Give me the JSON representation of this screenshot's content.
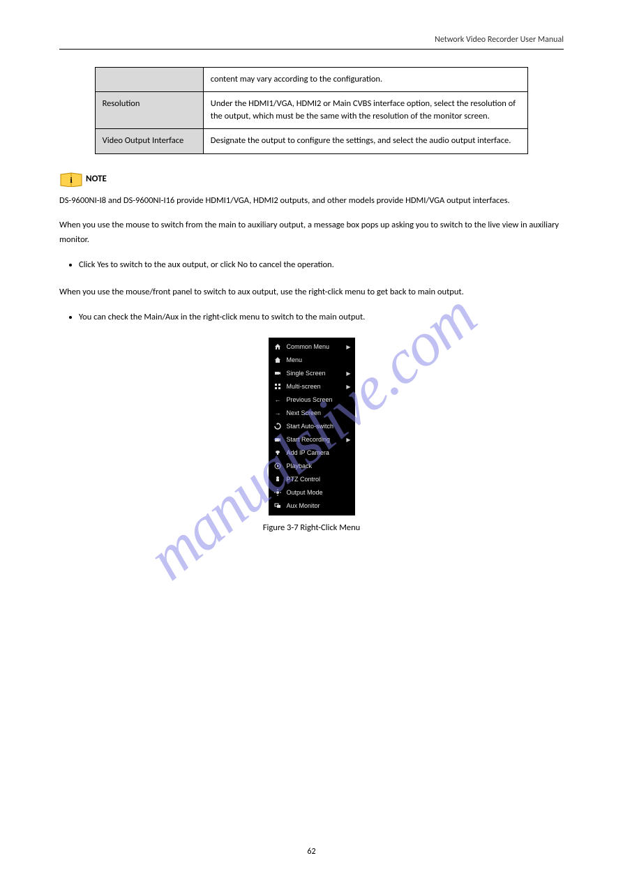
{
  "header": {
    "title": "Network Video Recorder User Manual"
  },
  "watermark": "manualslive.com",
  "table": {
    "rows": [
      {
        "label": "",
        "value": "content may vary according to the configuration."
      },
      {
        "label": "Resolution",
        "value": "Under the HDMI1/VGA, HDMI2 or Main CVBS interface option, select the resolution of the output, which must be the same with the resolution of the monitor screen."
      },
      {
        "label": "Video Output Interface",
        "value": "Designate the output to configure the settings, and select the audio output interface."
      }
    ]
  },
  "note": {
    "label": "NOTE"
  },
  "body": {
    "p1": "DS-9600NI-I8 and DS-9600NI-I16 provide HDMI1/VGA, HDMI2 outputs, and other models provide HDMI/VGA output interfaces.",
    "p2": "When you use the mouse to switch from the main to auxiliary output, a message box pops up asking you to switch to the live view in auxiliary monitor.",
    "p3": "When you use the mouse/front panel to switch to aux output, use the right-click menu to get back to main output."
  },
  "bullets": [
    "Click Yes to switch to the aux output, or click No to cancel the operation.",
    "You can check the Main/Aux in the right-click menu to switch to the main output."
  ],
  "menu": {
    "items": [
      {
        "icon": "home-roof",
        "label": "Common Menu",
        "sub": true
      },
      {
        "icon": "home",
        "label": "Menu",
        "sub": false
      },
      {
        "icon": "camera",
        "label": "Single Screen",
        "sub": true
      },
      {
        "icon": "grid",
        "label": "Multi-screen",
        "sub": true
      },
      {
        "icon": "left",
        "label": "Previous Screen",
        "sub": false
      },
      {
        "icon": "right",
        "label": "Next Screen",
        "sub": false
      },
      {
        "icon": "cycle",
        "label": "Start Auto-switch",
        "sub": false
      },
      {
        "icon": "rec",
        "label": "Start Recording",
        "sub": true
      },
      {
        "icon": "ipcam",
        "label": "Add IP Camera",
        "sub": false
      },
      {
        "icon": "play",
        "label": "Playback",
        "sub": false
      },
      {
        "icon": "ptz",
        "label": "PTZ Control",
        "sub": false
      },
      {
        "icon": "sun",
        "label": "Output Mode",
        "sub": false
      },
      {
        "icon": "aux",
        "label": "Aux Monitor",
        "sub": false
      }
    ]
  },
  "figure": {
    "caption": "Figure 3-7 Right-Click Menu"
  },
  "page_number": "62"
}
